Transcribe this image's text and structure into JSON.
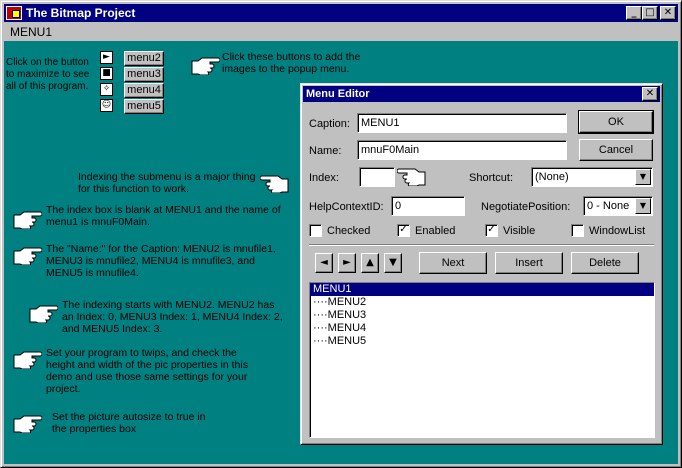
{
  "window": {
    "title": "The Bitmap Project",
    "min_icon": "minimize-icon",
    "max_icon": "maximize-icon",
    "close_icon": "close-icon"
  },
  "menubar": {
    "items": [
      "MENU1"
    ]
  },
  "notes": {
    "maximize": "Click on the button to maximize to see all of this program.",
    "add_images": "Click these buttons to add the images to the popup menu.",
    "indexing_major": "Indexing the submenu is a major thing for this function to work.",
    "index_blank": "The index box is blank at MENU1 and the name of menu1 is mnuF0Main.",
    "names": "The \"Name:\" for the Caption: MENU2 is mnufile1, MENU3 is mnufile2, MENU4 is mnufile3, and MENU5 is mnufile4.",
    "indexing_starts": "The indexing starts with MENU2. MENU2 has an Index: 0, MENU3 Index: 1, MENU4 Index: 2, and MENU5 Index: 3.",
    "twips": "Set your program to twips, and check the height and width of the pic properties in this demo and use those same settings for your project.",
    "autosize": "Set the picture autosize to true in the properties box"
  },
  "menu_buttons": [
    "menu2",
    "menu3",
    "menu4",
    "menu5"
  ],
  "menu_icons": [
    "play-icon",
    "stop-icon",
    "compass-icon",
    "smiley-icon"
  ],
  "menu_editor": {
    "title": "Menu Editor",
    "caption_label": "Caption:",
    "caption_value": "MENU1",
    "name_label": "Name:",
    "name_value": "mnuF0Main",
    "index_label": "Index:",
    "index_value": "",
    "shortcut_label": "Shortcut:",
    "shortcut_value": "(None)",
    "helpcontext_label": "HelpContextID:",
    "helpcontext_value": "0",
    "negotiate_label": "NegotiatePosition:",
    "negotiate_value": "0 - None",
    "ok_label": "OK",
    "cancel_label": "Cancel",
    "checkboxes": [
      {
        "label": "Checked",
        "checked": false
      },
      {
        "label": "Enabled",
        "checked": true
      },
      {
        "label": "Visible",
        "checked": true
      },
      {
        "label": "WindowList",
        "checked": false
      }
    ],
    "next_label": "Next",
    "insert_label": "Insert",
    "delete_label": "Delete",
    "menu_items": [
      "MENU1",
      "····MENU2",
      "····MENU3",
      "····MENU4",
      "····MENU5"
    ],
    "selected_item": "MENU1"
  },
  "colors": {
    "desktop_teal": "#008080",
    "title_blue": "#000080",
    "face_gray": "#c0c0c0"
  }
}
